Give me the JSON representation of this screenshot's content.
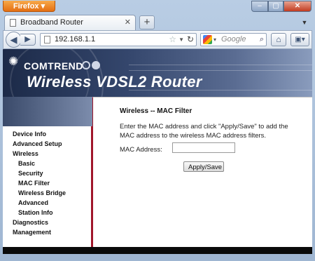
{
  "browser": {
    "app_button": "Firefox",
    "tab_title": "Broadband Router",
    "new_tab": "+",
    "url": "192.168.1.1",
    "search_placeholder": "Google",
    "controls": {
      "minimize": "–",
      "maximize": "▢",
      "close": "✕"
    }
  },
  "banner": {
    "brand": "COMTREND",
    "headline": "Wireless VDSL2 Router"
  },
  "sidebar": {
    "items": [
      {
        "label": "Device Info"
      },
      {
        "label": "Advanced Setup"
      },
      {
        "label": "Wireless"
      },
      {
        "label": "Basic"
      },
      {
        "label": "Security"
      },
      {
        "label": "MAC Filter"
      },
      {
        "label": "Wireless Bridge"
      },
      {
        "label": "Advanced"
      },
      {
        "label": "Station Info"
      },
      {
        "label": "Diagnostics"
      },
      {
        "label": "Management"
      }
    ]
  },
  "main": {
    "title": "Wireless -- MAC Filter",
    "description": "Enter the MAC address and click \"Apply/Save\" to add the MAC address to the wireless MAC address filters.",
    "mac_label": "MAC Address:",
    "mac_value": "",
    "apply_label": "Apply/Save"
  }
}
